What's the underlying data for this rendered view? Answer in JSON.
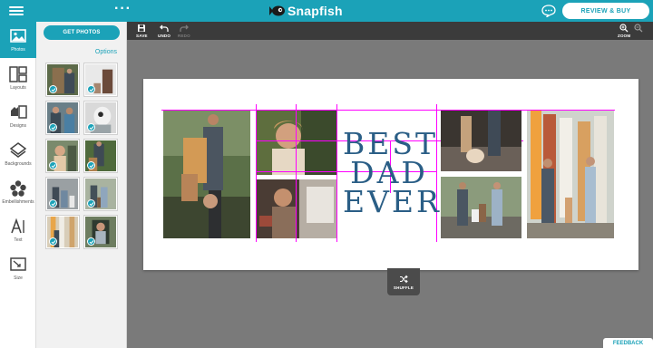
{
  "header": {
    "brand": "Snapfish",
    "review_button": "REVIEW & BUY",
    "accent_color": "#1ba2b8"
  },
  "rail": {
    "items": [
      {
        "label": "Photos",
        "icon": "photo-icon",
        "active": true
      },
      {
        "label": "Layouts",
        "icon": "layout-icon"
      },
      {
        "label": "Designs",
        "icon": "designs-icon"
      },
      {
        "label": "Backgrounds",
        "icon": "backgrounds-icon"
      },
      {
        "label": "Embellishments",
        "icon": "embellishment-icon"
      },
      {
        "label": "Text",
        "icon": "text-icon"
      },
      {
        "label": "Size",
        "icon": "size-icon"
      }
    ]
  },
  "panel": {
    "get_photos": "GET PHOTOS",
    "options": "Options"
  },
  "toolbar": {
    "save": "SAVE",
    "undo": "UNDO",
    "redo": "REDO",
    "zoom": "ZOOM"
  },
  "canvas": {
    "line1": "BEST",
    "line2": "DAD",
    "line3": "EVER"
  },
  "shuffle": "SHUFFLE",
  "feedback": "FEEDBACK"
}
